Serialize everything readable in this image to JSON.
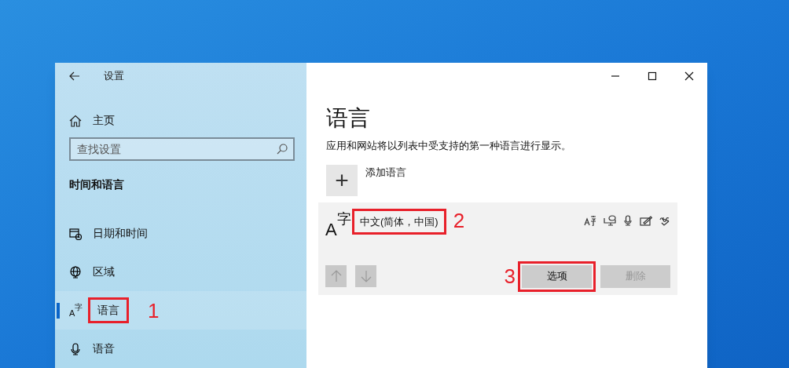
{
  "window": {
    "title": "设置"
  },
  "sidebar": {
    "home": "主页",
    "search": {
      "placeholder": "查找设置"
    },
    "section": "时间和语言",
    "items": [
      {
        "kind": "calendar",
        "label": "日期和时间",
        "selected": false
      },
      {
        "kind": "globe",
        "label": "区域",
        "selected": false
      },
      {
        "kind": "language",
        "icon_glyphs": [
          "A",
          "字"
        ],
        "label": "语言",
        "selected": true,
        "annotation": "1"
      },
      {
        "kind": "microphone",
        "label": "语音",
        "selected": false
      }
    ]
  },
  "content": {
    "title": "语言",
    "description": "应用和网站将以列表中受支持的第一种语言进行显示。",
    "add_button": {
      "icon": "+",
      "label": "添加语言"
    },
    "language": {
      "icon_glyphs": [
        "A",
        "字"
      ],
      "name": "中文(简体，中国)",
      "annotation": "2",
      "buttons": [
        {
          "label": "选项",
          "disabled": false,
          "annotation": "3"
        },
        {
          "label": "删除",
          "disabled": true
        }
      ]
    }
  }
}
